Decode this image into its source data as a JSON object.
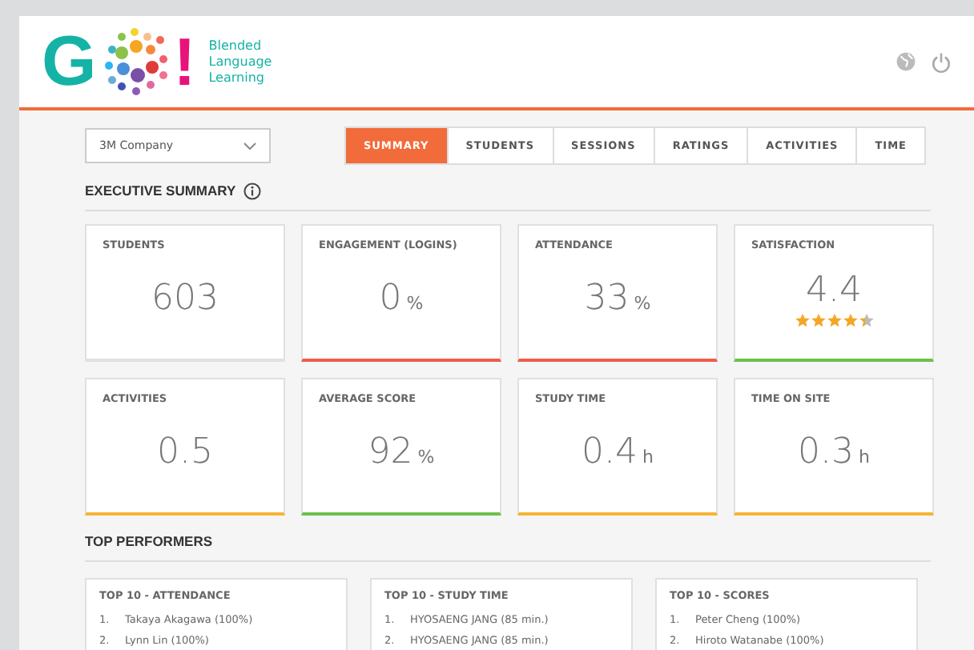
{
  "logo": {
    "mark": "G",
    "exclaim": "!",
    "tagline": [
      "Blended",
      "Language",
      "Learning"
    ]
  },
  "company_select": {
    "value": "3M Company"
  },
  "tabs": [
    {
      "label": "SUMMARY",
      "selected": true
    },
    {
      "label": "STUDENTS",
      "selected": false
    },
    {
      "label": "SESSIONS",
      "selected": false
    },
    {
      "label": "RATINGS",
      "selected": false
    },
    {
      "label": "ACTIVITIES",
      "selected": false
    },
    {
      "label": "TIME",
      "selected": false
    }
  ],
  "executive_summary": {
    "title": "EXECUTIVE SUMMARY",
    "cards": [
      {
        "label": "STUDENTS",
        "value": "603"
      },
      {
        "label": "ENGAGEMENT (LOGINS)",
        "value": "0",
        "unit": "%",
        "color": "#f05a4a"
      },
      {
        "label": "ATTENDANCE",
        "value": "33",
        "unit": "%",
        "color": "#f05a4a"
      },
      {
        "label": "SATISFACTION",
        "value": "4.4",
        "stars": 4.4,
        "color": "#6cc04a"
      },
      {
        "label": "ACTIVITIES",
        "value": "0.5",
        "color": "#f5b335"
      },
      {
        "label": "AVERAGE SCORE",
        "value": "92",
        "unit": "%",
        "color": "#6cc04a"
      },
      {
        "label": "STUDY TIME",
        "value": "0.4",
        "unit": "h",
        "color": "#f5b335"
      },
      {
        "label": "TIME ON SITE",
        "value": "0.3",
        "unit": "h",
        "color": "#f5b335"
      }
    ]
  },
  "top_performers": {
    "title": "TOP PERFORMERS",
    "panels": [
      {
        "title": "TOP 10 - ATTENDANCE",
        "items": [
          {
            "rank": "1.",
            "text": "Takaya Akagawa (100%)"
          },
          {
            "rank": "2.",
            "text": "Lynn Lin (100%)"
          }
        ]
      },
      {
        "title": "TOP 10 - STUDY TIME",
        "items": [
          {
            "rank": "1.",
            "text": "HYOSAENG JANG (85 min.)"
          },
          {
            "rank": "2.",
            "text": "HYOSAENG JANG (85 min.)"
          }
        ]
      },
      {
        "title": "TOP 10 - SCORES",
        "items": [
          {
            "rank": "1.",
            "text": "Peter Cheng (100%)"
          },
          {
            "rank": "2.",
            "text": "Hiroto Watanabe (100%)"
          }
        ]
      }
    ]
  }
}
